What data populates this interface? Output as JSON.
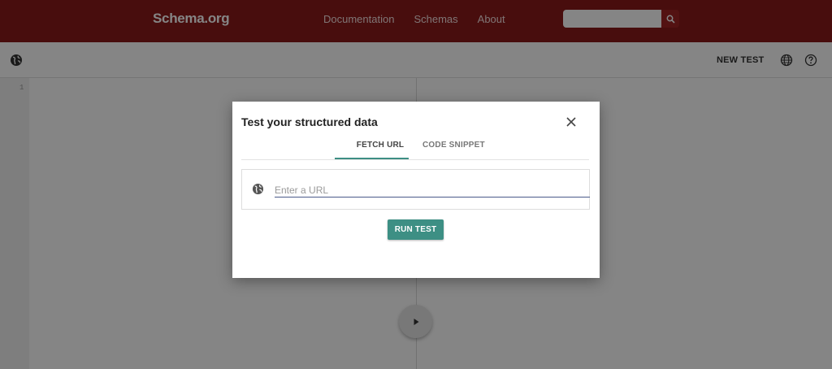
{
  "nav": {
    "logo": "Schema.org",
    "links": [
      "Documentation",
      "Schemas",
      "About"
    ],
    "search_placeholder": "",
    "search_icon": "search-icon"
  },
  "toolbar": {
    "left_icon": "globe-icon",
    "new_test_label": "NEW TEST",
    "language_icon": "language-icon",
    "help_icon": "help-icon"
  },
  "editor": {
    "line_numbers": [
      "1"
    ],
    "run_icon": "play-icon"
  },
  "dialog": {
    "title": "Test your structured data",
    "close_icon": "close-icon",
    "tabs": [
      {
        "label": "FETCH URL",
        "active": true
      },
      {
        "label": "CODE SNIPPET",
        "active": false
      }
    ],
    "url_icon": "globe-icon",
    "url_placeholder": "Enter a URL",
    "url_value": "",
    "run_label": "RUN TEST"
  },
  "colors": {
    "nav_bg": "#8b1a1a",
    "accent": "#3d8f84",
    "input_underline": "#4b5b8a"
  }
}
